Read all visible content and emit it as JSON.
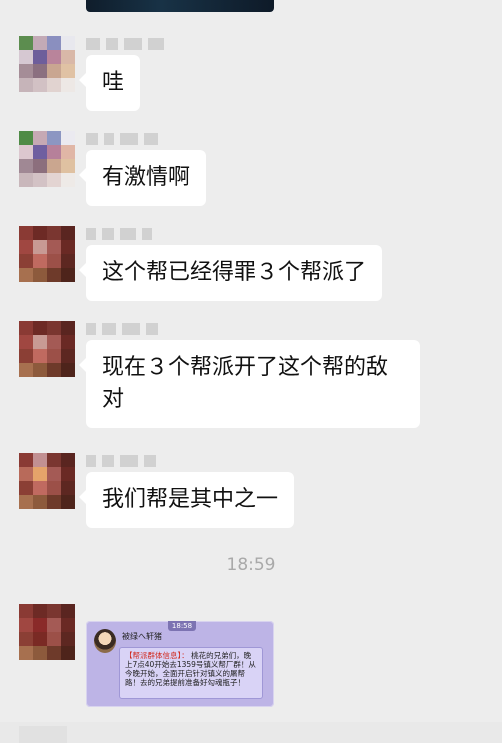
{
  "messages": [
    {
      "text": "哇"
    },
    {
      "text": "有激情啊"
    },
    {
      "text": "这个帮已经得罪３个帮派了"
    },
    {
      "text": "现在３个帮派开了这个帮的敌对"
    },
    {
      "text": "我们帮是其中之一"
    }
  ],
  "timestamp": "18:59",
  "shared_image": {
    "time": "18:58",
    "sender": "被绿へ轩猪",
    "body_red": "【帮派群体信息】：",
    "body": "桃花的兄弟们，晚上7点40开始去1359号镇义帮厂群！从今晚开始，全面开启针对镇义的屠帮路！去的兄弟提前准备好勾魂瓶子！"
  },
  "colors": {
    "background": "#ededed",
    "bubble": "#ffffff",
    "timestamp": "#a9a9a9",
    "card": "#bdb4e6"
  }
}
